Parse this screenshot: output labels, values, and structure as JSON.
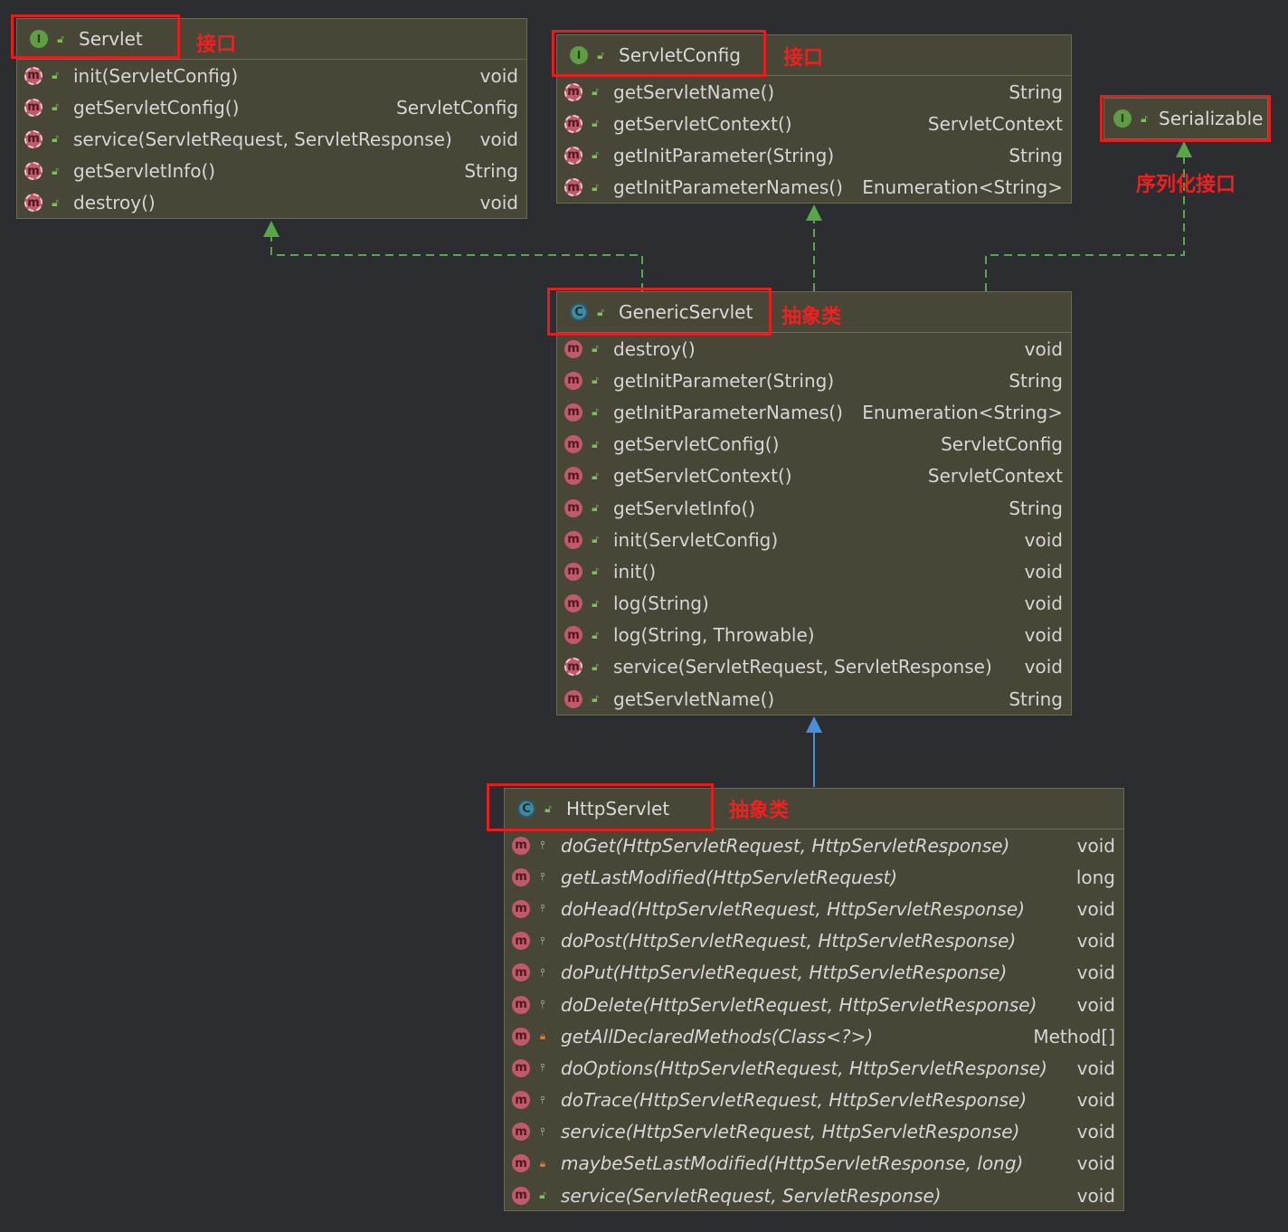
{
  "labels": {
    "servlet": "接口",
    "servlet_config": "接口",
    "serializable": "序列化接口",
    "generic_servlet": "抽象类",
    "http_servlet": "抽象类"
  },
  "colors": {
    "background": "#2b2d30",
    "box_fill": "#484636",
    "annotation_red": "#e02020",
    "realization_arrow": "#57a64a",
    "inheritance_arrow": "#4a90d9"
  },
  "servlet": {
    "name": "Servlet",
    "kind_icon": "interface-icon",
    "methods": [
      {
        "name": "init(ServletConfig)",
        "type": "void"
      },
      {
        "name": "getServletConfig()",
        "type": "ServletConfig"
      },
      {
        "name": "service(ServletRequest, ServletResponse)",
        "type": "void"
      },
      {
        "name": "getServletInfo()",
        "type": "String"
      },
      {
        "name": "destroy()",
        "type": "void"
      }
    ]
  },
  "servlet_config": {
    "name": "ServletConfig",
    "kind_icon": "interface-icon",
    "methods": [
      {
        "name": "getServletName()",
        "type": "String"
      },
      {
        "name": "getServletContext()",
        "type": "ServletContext"
      },
      {
        "name": "getInitParameter(String)",
        "type": "String"
      },
      {
        "name": "getInitParameterNames()",
        "type": "Enumeration<String>"
      }
    ]
  },
  "serializable": {
    "name": "Serializable",
    "kind_icon": "interface-icon"
  },
  "generic_servlet": {
    "name": "GenericServlet",
    "kind_icon": "abstract-class-icon",
    "methods": [
      {
        "name": "destroy()",
        "type": "void"
      },
      {
        "name": "getInitParameter(String)",
        "type": "String"
      },
      {
        "name": "getInitParameterNames()",
        "type": "Enumeration<String>"
      },
      {
        "name": "getServletConfig()",
        "type": "ServletConfig"
      },
      {
        "name": "getServletContext()",
        "type": "ServletContext"
      },
      {
        "name": "getServletInfo()",
        "type": "String"
      },
      {
        "name": "init(ServletConfig)",
        "type": "void"
      },
      {
        "name": "init()",
        "type": "void"
      },
      {
        "name": "log(String)",
        "type": "void"
      },
      {
        "name": "log(String, Throwable)",
        "type": "void"
      },
      {
        "name": "service(ServletRequest, ServletResponse)",
        "type": "void"
      },
      {
        "name": "getServletName()",
        "type": "String"
      }
    ]
  },
  "http_servlet": {
    "name": "HttpServlet",
    "kind_icon": "abstract-class-icon",
    "methods": [
      {
        "name": "doGet(HttpServletRequest, HttpServletResponse)",
        "type": "void"
      },
      {
        "name": "getLastModified(HttpServletRequest)",
        "type": "long"
      },
      {
        "name": "doHead(HttpServletRequest, HttpServletResponse)",
        "type": "void"
      },
      {
        "name": "doPost(HttpServletRequest, HttpServletResponse)",
        "type": "void"
      },
      {
        "name": "doPut(HttpServletRequest, HttpServletResponse)",
        "type": "void"
      },
      {
        "name": "doDelete(HttpServletRequest, HttpServletResponse)",
        "type": "void"
      },
      {
        "name": "getAllDeclaredMethods(Class<?>)",
        "type": "Method[]"
      },
      {
        "name": "doOptions(HttpServletRequest, HttpServletResponse)",
        "type": "void"
      },
      {
        "name": "doTrace(HttpServletRequest, HttpServletResponse)",
        "type": "void"
      },
      {
        "name": "service(HttpServletRequest, HttpServletResponse)",
        "type": "void"
      },
      {
        "name": "maybeSetLastModified(HttpServletResponse, long)",
        "type": "void"
      },
      {
        "name": "service(ServletRequest, ServletResponse)",
        "type": "void"
      }
    ]
  }
}
